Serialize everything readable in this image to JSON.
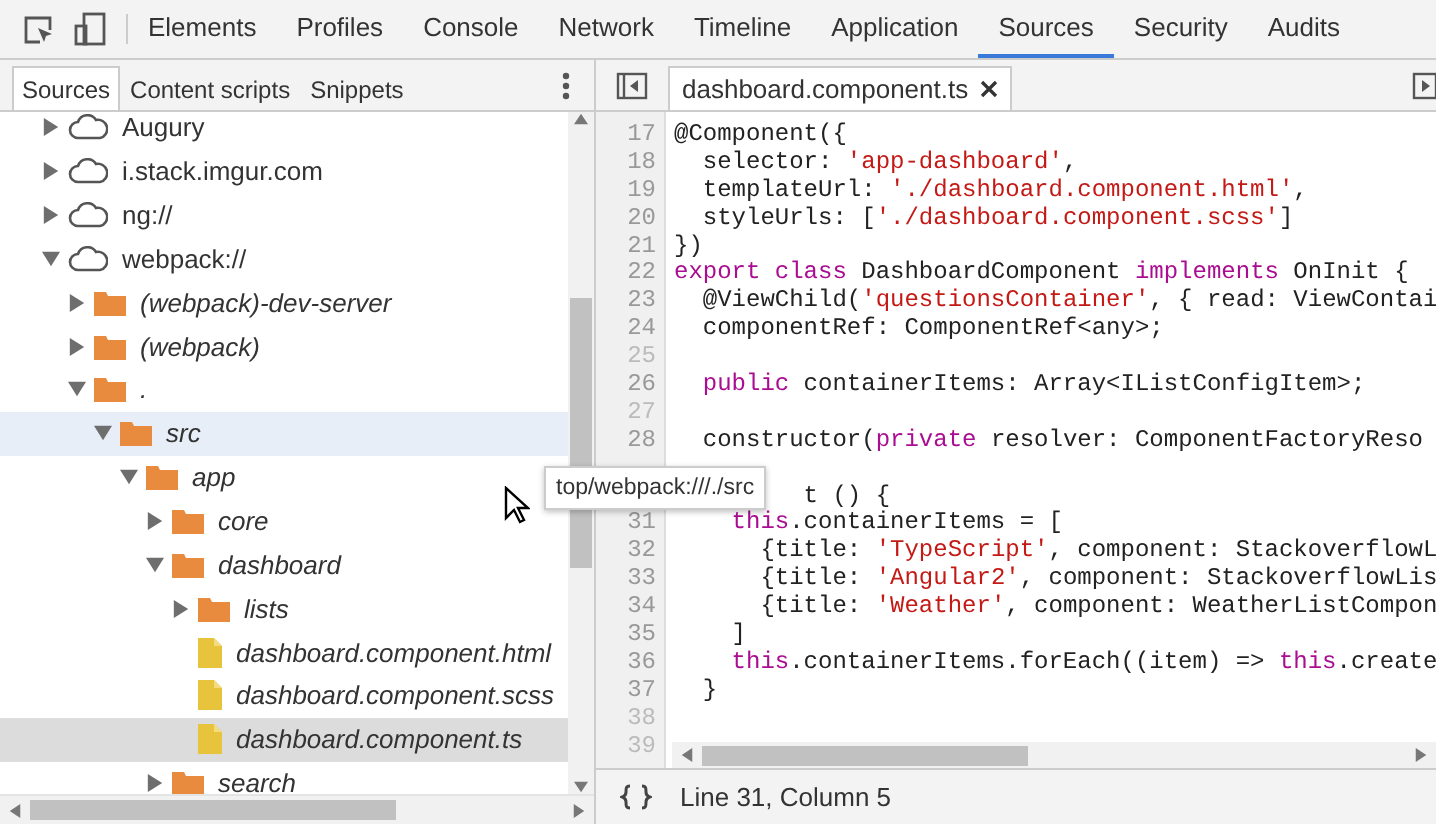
{
  "toolbar": {
    "tabs": [
      {
        "label": "Elements",
        "selected": false
      },
      {
        "label": "Profiles",
        "selected": false
      },
      {
        "label": "Console",
        "selected": false
      },
      {
        "label": "Network",
        "selected": false
      },
      {
        "label": "Timeline",
        "selected": false
      },
      {
        "label": "Application",
        "selected": false
      },
      {
        "label": "Sources",
        "selected": true
      },
      {
        "label": "Security",
        "selected": false
      },
      {
        "label": "Audits",
        "selected": false
      }
    ]
  },
  "navigator": {
    "tabs": [
      {
        "label": "Sources",
        "selected": true
      },
      {
        "label": "Content scripts",
        "selected": false
      },
      {
        "label": "Snippets",
        "selected": false
      }
    ],
    "tree": [
      {
        "label": "Augury",
        "kind": "domain",
        "expanded": false,
        "selected": false,
        "hovered": false
      },
      {
        "label": "i.stack.imgur.com",
        "kind": "domain",
        "expanded": false,
        "selected": false,
        "hovered": false
      },
      {
        "label": "ng://",
        "kind": "domain",
        "expanded": false,
        "selected": false,
        "hovered": false
      },
      {
        "label": "webpack://",
        "kind": "domain",
        "expanded": true,
        "selected": false,
        "hovered": false,
        "children": [
          {
            "label": "(webpack)-dev-server",
            "kind": "folder",
            "expanded": false,
            "selected": false,
            "hovered": false
          },
          {
            "label": "(webpack)",
            "kind": "folder",
            "expanded": false,
            "selected": false,
            "hovered": false
          },
          {
            "label": ".",
            "kind": "folder",
            "expanded": true,
            "selected": false,
            "hovered": false,
            "children": [
              {
                "label": "src",
                "kind": "folder",
                "expanded": true,
                "selected": false,
                "hovered": true,
                "children": [
                  {
                    "label": "app",
                    "kind": "folder",
                    "expanded": true,
                    "selected": false,
                    "hovered": false,
                    "children": [
                      {
                        "label": "core",
                        "kind": "folder",
                        "expanded": false,
                        "selected": false,
                        "hovered": false
                      },
                      {
                        "label": "dashboard",
                        "kind": "folder",
                        "expanded": true,
                        "selected": false,
                        "hovered": false,
                        "children": [
                          {
                            "label": "lists",
                            "kind": "folder",
                            "expanded": false,
                            "selected": false,
                            "hovered": false
                          },
                          {
                            "label": "dashboard.component.html",
                            "kind": "file",
                            "selected": false,
                            "hovered": false
                          },
                          {
                            "label": "dashboard.component.scss",
                            "kind": "file",
                            "selected": false,
                            "hovered": false
                          },
                          {
                            "label": "dashboard.component.ts",
                            "kind": "file",
                            "selected": true,
                            "hovered": false
                          }
                        ]
                      },
                      {
                        "label": "search",
                        "kind": "folder",
                        "expanded": false,
                        "selected": false,
                        "hovered": false
                      }
                    ]
                  }
                ]
              }
            ]
          }
        ]
      }
    ],
    "tooltip": "top/webpack:///./src"
  },
  "editor": {
    "tabs": [
      {
        "label": "dashboard.component.ts",
        "selected": true
      }
    ],
    "lines": [
      {
        "kind": "numbered",
        "num": "17",
        "tokens": [
          {
            "t": "@Component({",
            "kind": "plain"
          }
        ]
      },
      {
        "kind": "numbered",
        "num": "18",
        "tokens": [
          {
            "t": "  selector: ",
            "kind": "plain"
          },
          {
            "t": "'app-dashboard'",
            "kind": "string"
          },
          {
            "t": ",",
            "kind": "plain"
          }
        ]
      },
      {
        "kind": "numbered",
        "num": "19",
        "tokens": [
          {
            "t": "  templateUrl: ",
            "kind": "plain"
          },
          {
            "t": "'./dashboard.component.html'",
            "kind": "string"
          },
          {
            "t": ",",
            "kind": "plain"
          }
        ]
      },
      {
        "kind": "numbered",
        "num": "20",
        "tokens": [
          {
            "t": "  styleUrls: [",
            "kind": "plain"
          },
          {
            "t": "'./dashboard.component.scss'",
            "kind": "string"
          },
          {
            "t": "]",
            "kind": "plain"
          }
        ]
      },
      {
        "kind": "numbered",
        "num": "21",
        "tokens": [
          {
            "t": "})",
            "kind": "plain"
          }
        ]
      },
      {
        "kind": "numbered",
        "num": "22",
        "tokens": [
          {
            "t": "export class",
            "kind": "keyword"
          },
          {
            "t": " DashboardComponent ",
            "kind": "plain"
          },
          {
            "t": "implements",
            "kind": "keyword"
          },
          {
            "t": " OnInit {",
            "kind": "plain"
          }
        ]
      },
      {
        "kind": "numbered",
        "num": "23",
        "tokens": [
          {
            "t": "  @ViewChild(",
            "kind": "plain"
          },
          {
            "t": "'questionsContainer'",
            "kind": "string"
          },
          {
            "t": ", { read: ViewContai",
            "kind": "plain"
          }
        ]
      },
      {
        "kind": "numbered",
        "num": "24",
        "tokens": [
          {
            "t": "  componentRef: ComponentRef<any>;",
            "kind": "plain"
          }
        ]
      },
      {
        "kind": "numbered",
        "num": "25"
      },
      {
        "kind": "numbered",
        "num": "26",
        "tokens": [
          {
            "t": "  public",
            "kind": "keyword"
          },
          {
            "t": " containerItems: Array<IListConfigItem>;",
            "kind": "plain"
          }
        ]
      },
      {
        "kind": "numbered",
        "num": "27"
      },
      {
        "kind": "numbered",
        "num": "28",
        "tokens": [
          {
            "t": "  constructor(",
            "kind": "plain"
          },
          {
            "t": "private",
            "kind": "keyword"
          },
          {
            "t": " resolver: ComponentFactoryReso",
            "kind": "plain"
          }
        ]
      },
      {
        "kind": "covered"
      },
      {
        "kind": "covered",
        "tokens": [
          {
            "t": "         t () {",
            "kind": "plain"
          }
        ]
      },
      {
        "kind": "numbered",
        "num": "31",
        "tokens": [
          {
            "t": "    this",
            "kind": "keyword"
          },
          {
            "t": ".containerItems = [",
            "kind": "plain"
          }
        ]
      },
      {
        "kind": "numbered",
        "num": "32",
        "tokens": [
          {
            "t": "      {title: ",
            "kind": "plain"
          },
          {
            "t": "'TypeScript'",
            "kind": "string"
          },
          {
            "t": ", component: StackoverflowL",
            "kind": "plain"
          }
        ]
      },
      {
        "kind": "numbered",
        "num": "33",
        "tokens": [
          {
            "t": "      {title: ",
            "kind": "plain"
          },
          {
            "t": "'Angular2'",
            "kind": "string"
          },
          {
            "t": ", component: StackoverflowLis",
            "kind": "plain"
          }
        ]
      },
      {
        "kind": "numbered",
        "num": "34",
        "tokens": [
          {
            "t": "      {title: ",
            "kind": "plain"
          },
          {
            "t": "'Weather'",
            "kind": "string"
          },
          {
            "t": ", component: WeatherListCompon",
            "kind": "plain"
          }
        ]
      },
      {
        "kind": "numbered",
        "num": "35",
        "tokens": [
          {
            "t": "    ]",
            "kind": "plain"
          }
        ]
      },
      {
        "kind": "numbered",
        "num": "36",
        "tokens": [
          {
            "t": "    this",
            "kind": "keyword"
          },
          {
            "t": ".containerItems.forEach((item) => ",
            "kind": "plain"
          },
          {
            "t": "this",
            "kind": "keyword"
          },
          {
            "t": ".create",
            "kind": "plain"
          }
        ]
      },
      {
        "kind": "numbered",
        "num": "37",
        "tokens": [
          {
            "t": "  }",
            "kind": "plain"
          }
        ]
      },
      {
        "kind": "numbered",
        "num": "38"
      },
      {
        "kind": "numbered",
        "num": "39"
      }
    ]
  },
  "status_bar": {
    "position": "Line 31, Column 5"
  }
}
